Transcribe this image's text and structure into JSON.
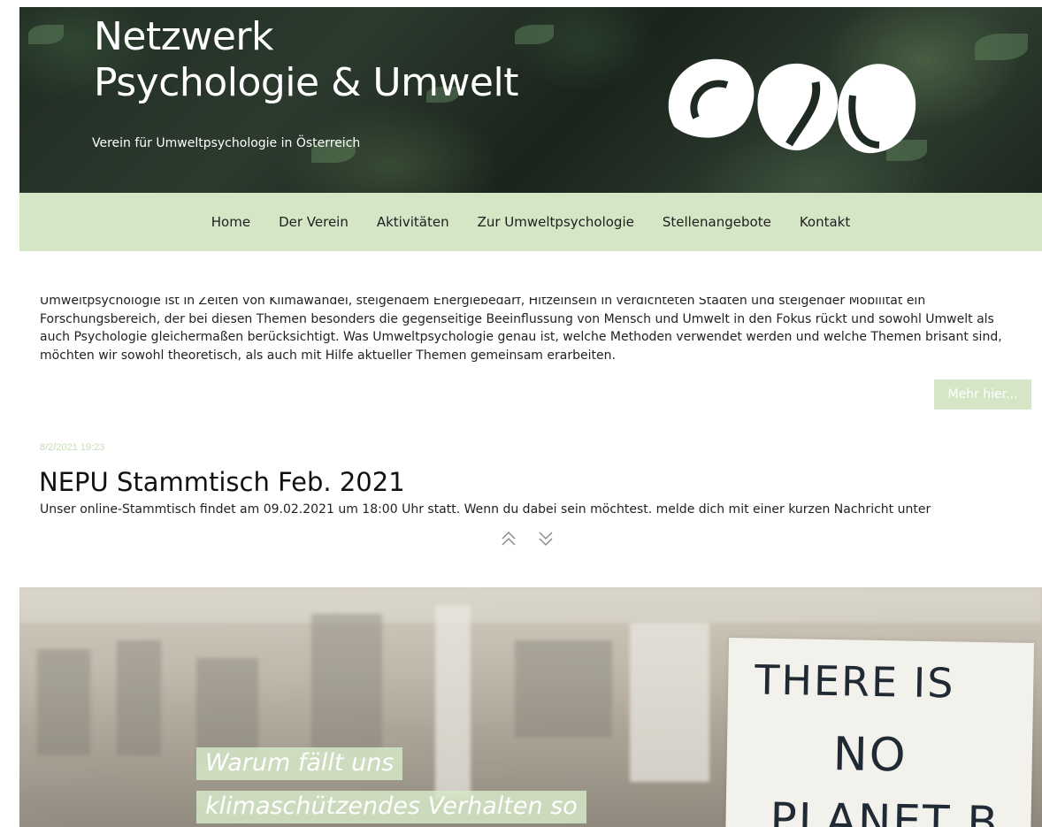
{
  "brand": {
    "title_line1": "Netzwerk",
    "title_line2": "Psychologie & Umwelt",
    "subtitle": "Verein für Umweltpsychologie in Österreich",
    "logo_icon": "nepu-logo-icon"
  },
  "nav": {
    "items": [
      {
        "label": "Home"
      },
      {
        "label": "Der Verein"
      },
      {
        "label": "Aktivitäten"
      },
      {
        "label": "Zur Umweltpsychologie"
      },
      {
        "label": "Stellenangebote"
      },
      {
        "label": "Kontakt"
      }
    ]
  },
  "intro": {
    "text": "Umweltpsychologie ist in Zeiten von Klimawandel, steigendem Energiebedarf, Hitzeinseln in verdichteten Städten und steigender Mobilität ein Forschungsbereich, der bei diesen Themen besonders die gegenseitige Beeinflussung von Mensch und Umwelt in den Fokus rückt und sowohl Umwelt als auch Psychologie gleichermaßen berücksichtigt. Was Umweltpsychologie genau ist, welche Methoden verwendet werden und welche Themen brisant sind, möchten wir sowohl theoretisch, als auch mit Hilfe aktueller Themen gemeinsam erarbeiten.",
    "more_label": "Mehr hier..."
  },
  "post": {
    "date": "8/2/2021 19:23",
    "title": "NEPU Stammtisch Feb. 2021",
    "excerpt": "Unser online-Stammtisch findet am 09.02.2021 um 18:00 Uhr statt. Wenn du dabei sein möchtest. melde dich mit einer kurzen Nachricht unter",
    "prev_icon": "double-chevron-up-icon",
    "next_icon": "double-chevron-down-icon"
  },
  "banner": {
    "caption_line1": "Warum fällt uns",
    "caption_line2": "klimaschützendes Verhalten so",
    "sign_line1": "THERE IS",
    "sign_line2": "NO",
    "sign_line3": "PLANET B"
  },
  "colors": {
    "accent": "#d5e6c7",
    "date": "#c7dcb7"
  }
}
